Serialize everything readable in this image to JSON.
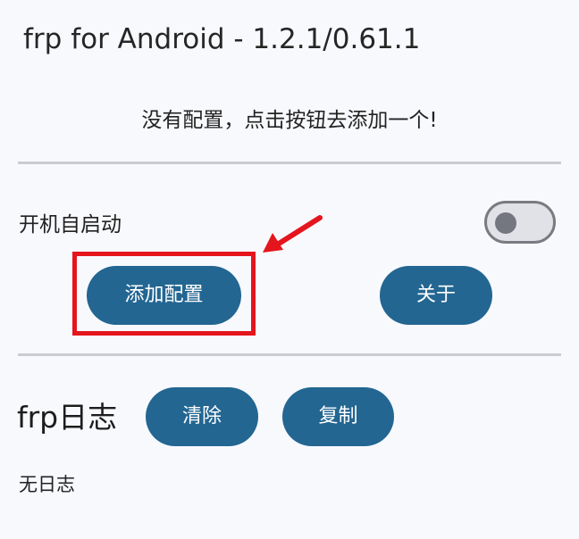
{
  "app": {
    "title": "frp for Android - 1.2.1/0.61.1"
  },
  "config": {
    "empty_hint": "没有配置，点击按钮去添加一个!"
  },
  "settings": {
    "autostart_label": "开机自启动",
    "autostart_enabled": false
  },
  "actions": {
    "add_config_label": "添加配置",
    "about_label": "关于"
  },
  "log": {
    "title": "frp日志",
    "clear_label": "清除",
    "copy_label": "复制",
    "content": "无日志"
  },
  "colors": {
    "button_primary": "#236692",
    "highlight": "#e4151d",
    "background": "#f8f9fd",
    "divider": "#c9ccd2"
  },
  "icons": {
    "annotation_arrow": "arrow-icon"
  }
}
